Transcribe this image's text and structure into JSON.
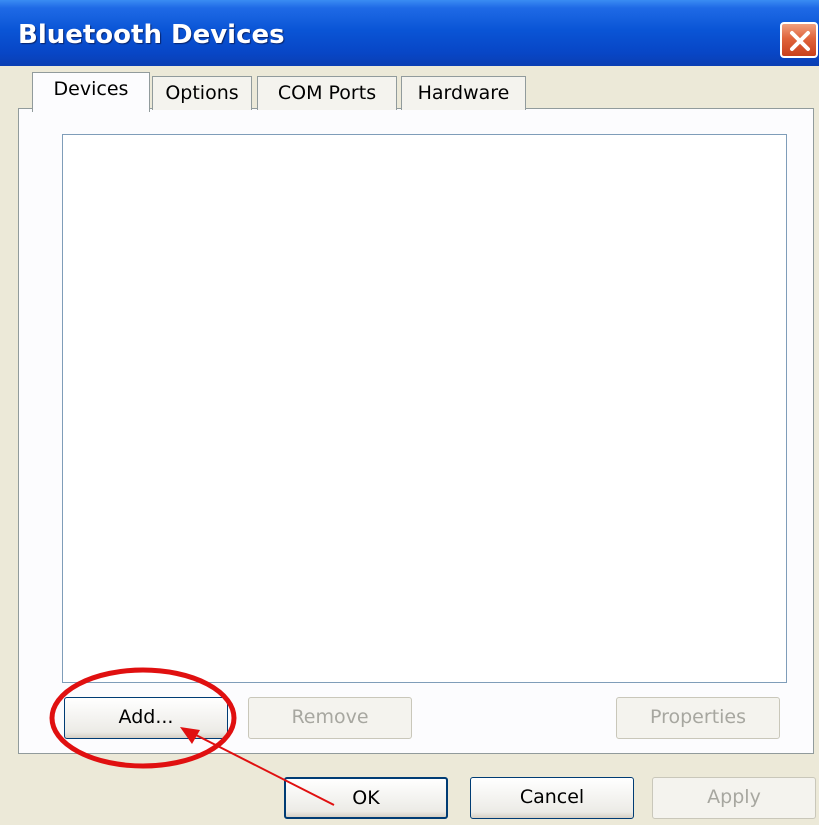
{
  "window": {
    "title": "Bluetooth Devices"
  },
  "tabs": [
    {
      "label": "Devices",
      "active": true
    },
    {
      "label": "Options",
      "active": false
    },
    {
      "label": "COM Ports",
      "active": false
    },
    {
      "label": "Hardware",
      "active": false
    }
  ],
  "device_buttons": {
    "add": "Add...",
    "remove": "Remove",
    "properties": "Properties"
  },
  "dialog_buttons": {
    "ok": "OK",
    "cancel": "Cancel",
    "apply": "Apply"
  },
  "annotation": {
    "color": "#e01010"
  }
}
